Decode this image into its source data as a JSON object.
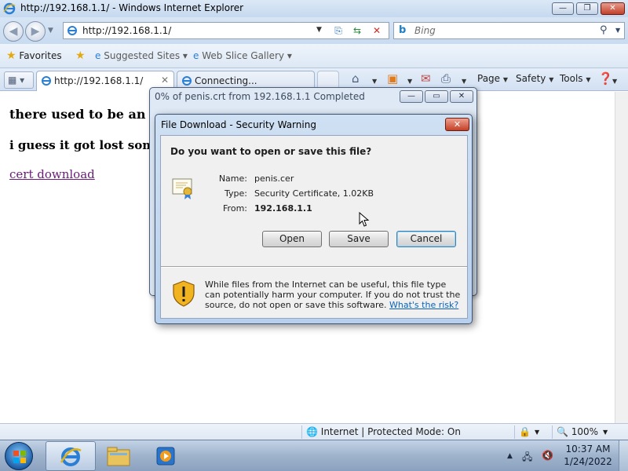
{
  "window": {
    "title": "http://192.168.1.1/ - Windows Internet Explorer",
    "minimize_label": "—",
    "maximize_label": "❐",
    "close_label": "✕"
  },
  "nav": {
    "back_glyph": "◀",
    "forward_glyph": "▶",
    "dropdown_glyph": "▼"
  },
  "address_bar": {
    "url": "http://192.168.1.1/",
    "dropdown_glyph": "▼"
  },
  "search": {
    "logo": "b",
    "placeholder": "Bing",
    "search_glyph": "⚲",
    "dropdown_glyph": "▼"
  },
  "favorites_bar": {
    "favorites_label": "Favorites",
    "items": [
      {
        "label": "Suggested Sites ▾"
      },
      {
        "label": "Web Slice Gallery ▾"
      }
    ]
  },
  "tabs": [
    {
      "label": "http://192.168.1.1/",
      "close": "✕"
    },
    {
      "label": "Connecting..."
    }
  ],
  "command_bar": {
    "items": [
      {
        "label": "Page"
      },
      {
        "label": "Safety"
      },
      {
        "label": "Tools"
      }
    ],
    "dropdown_glyph": "▼"
  },
  "page": {
    "line1": "there used to be an ind",
    "line2": "i guess it got lost somewhe",
    "link": "cert download"
  },
  "status_bar": {
    "zone": "Internet | Protected Mode: On",
    "zoom": "100%",
    "zoom_dropdown": "▼"
  },
  "progress_dialog": {
    "title": "0% of penis.crt from 192.168.1.1 Completed"
  },
  "security_dialog": {
    "title": "File Download - Security Warning",
    "close_label": "✕",
    "question": "Do you want to open or save this file?",
    "fields": {
      "name_label": "Name:",
      "name_value": "penis.cer",
      "type_label": "Type:",
      "type_value": "Security Certificate, 1.02KB",
      "from_label": "From:",
      "from_value": "192.168.1.1"
    },
    "buttons": {
      "open": "Open",
      "save": "Save",
      "cancel": "Cancel"
    },
    "warning_text": "While files from the Internet can be useful, this file type can potentially harm your computer. If you do not trust the source, do not open or save this software.",
    "risk_link": "What's the risk?"
  },
  "taskbar": {
    "tray_arrow": "▲",
    "time": "10:37 AM",
    "date": "1/24/2022"
  },
  "colors": {
    "link_visited": "#6a1b7a",
    "risk_link": "#0b62b8",
    "dialog_border": "#3d5478"
  }
}
